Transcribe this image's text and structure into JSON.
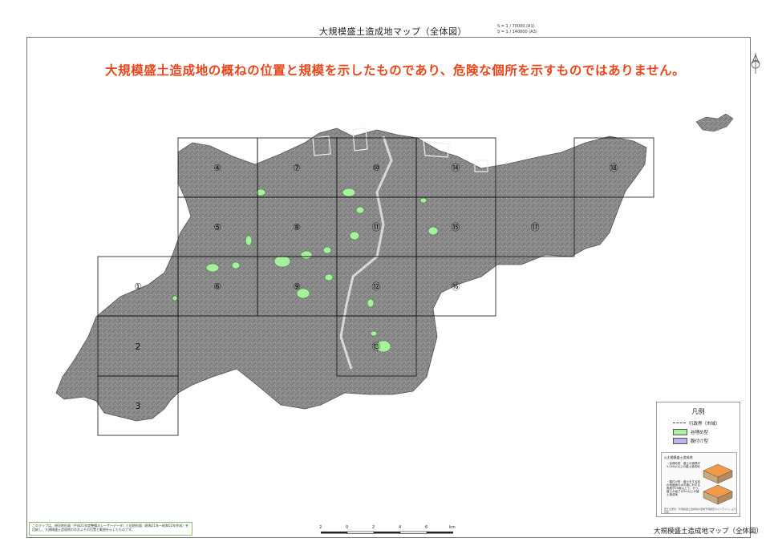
{
  "title": "大規模盛土造成地マップ（全体図）",
  "scale_note": [
    "S = 1 / 70000 (A1)",
    "S = 1 / 140000 (A3)"
  ],
  "warning": "大規模盛土造成地の概ねの位置と規模を示したものであり、危険な個所を示すものではありません。",
  "grid_labels": [
    "①",
    "2",
    "3",
    "④",
    "⑤",
    "⑥",
    "⑦",
    "⑧",
    "⑨",
    "⑩",
    "⑪",
    "⑫",
    "⑬",
    "⑭",
    "⑮",
    "⑯",
    "⑰",
    "⑱"
  ],
  "legend": {
    "title": "凡例",
    "items": [
      {
        "label": "行政界（市域）",
        "kind": "line",
        "color": "#444444"
      },
      {
        "label": "谷埋め型",
        "kind": "fill",
        "color": "#a8f0a0"
      },
      {
        "label": "腹付け型",
        "kind": "fill",
        "color": "#b6b6f2"
      }
    ],
    "detail_heading": "◎大規模盛土造成地",
    "detail_type1": "・谷埋め型　盛土の面積が3,000㎡以上の盛土造成地",
    "detail_type2": "・腹付け型　盛土をする前の地盤面の水平面に対する角度が20度以上で、かつ、盛土の高さが5m以上の盛土造成地",
    "detail_footer": "国土交通省「大規模盛土造成地の変動予測調査ガイドライン」より作成"
  },
  "note": "このマップは、現況地形図（平成21年度整備のレーザーデータ）と旧地形図（昭和21年～昭和52年作成）を比較し、大規模盛土造成地のおおよその位置と範囲を示したものです。",
  "scale_bar": {
    "ticks": [
      "2",
      "0",
      "2",
      "4",
      "6"
    ],
    "unit": "km"
  },
  "bottom_title": "大規模盛土造成地マップ（全体図）",
  "colors": {
    "warning": "#e8461a",
    "land": "#8a8a8a",
    "fill_area": "#a8f0a0"
  }
}
